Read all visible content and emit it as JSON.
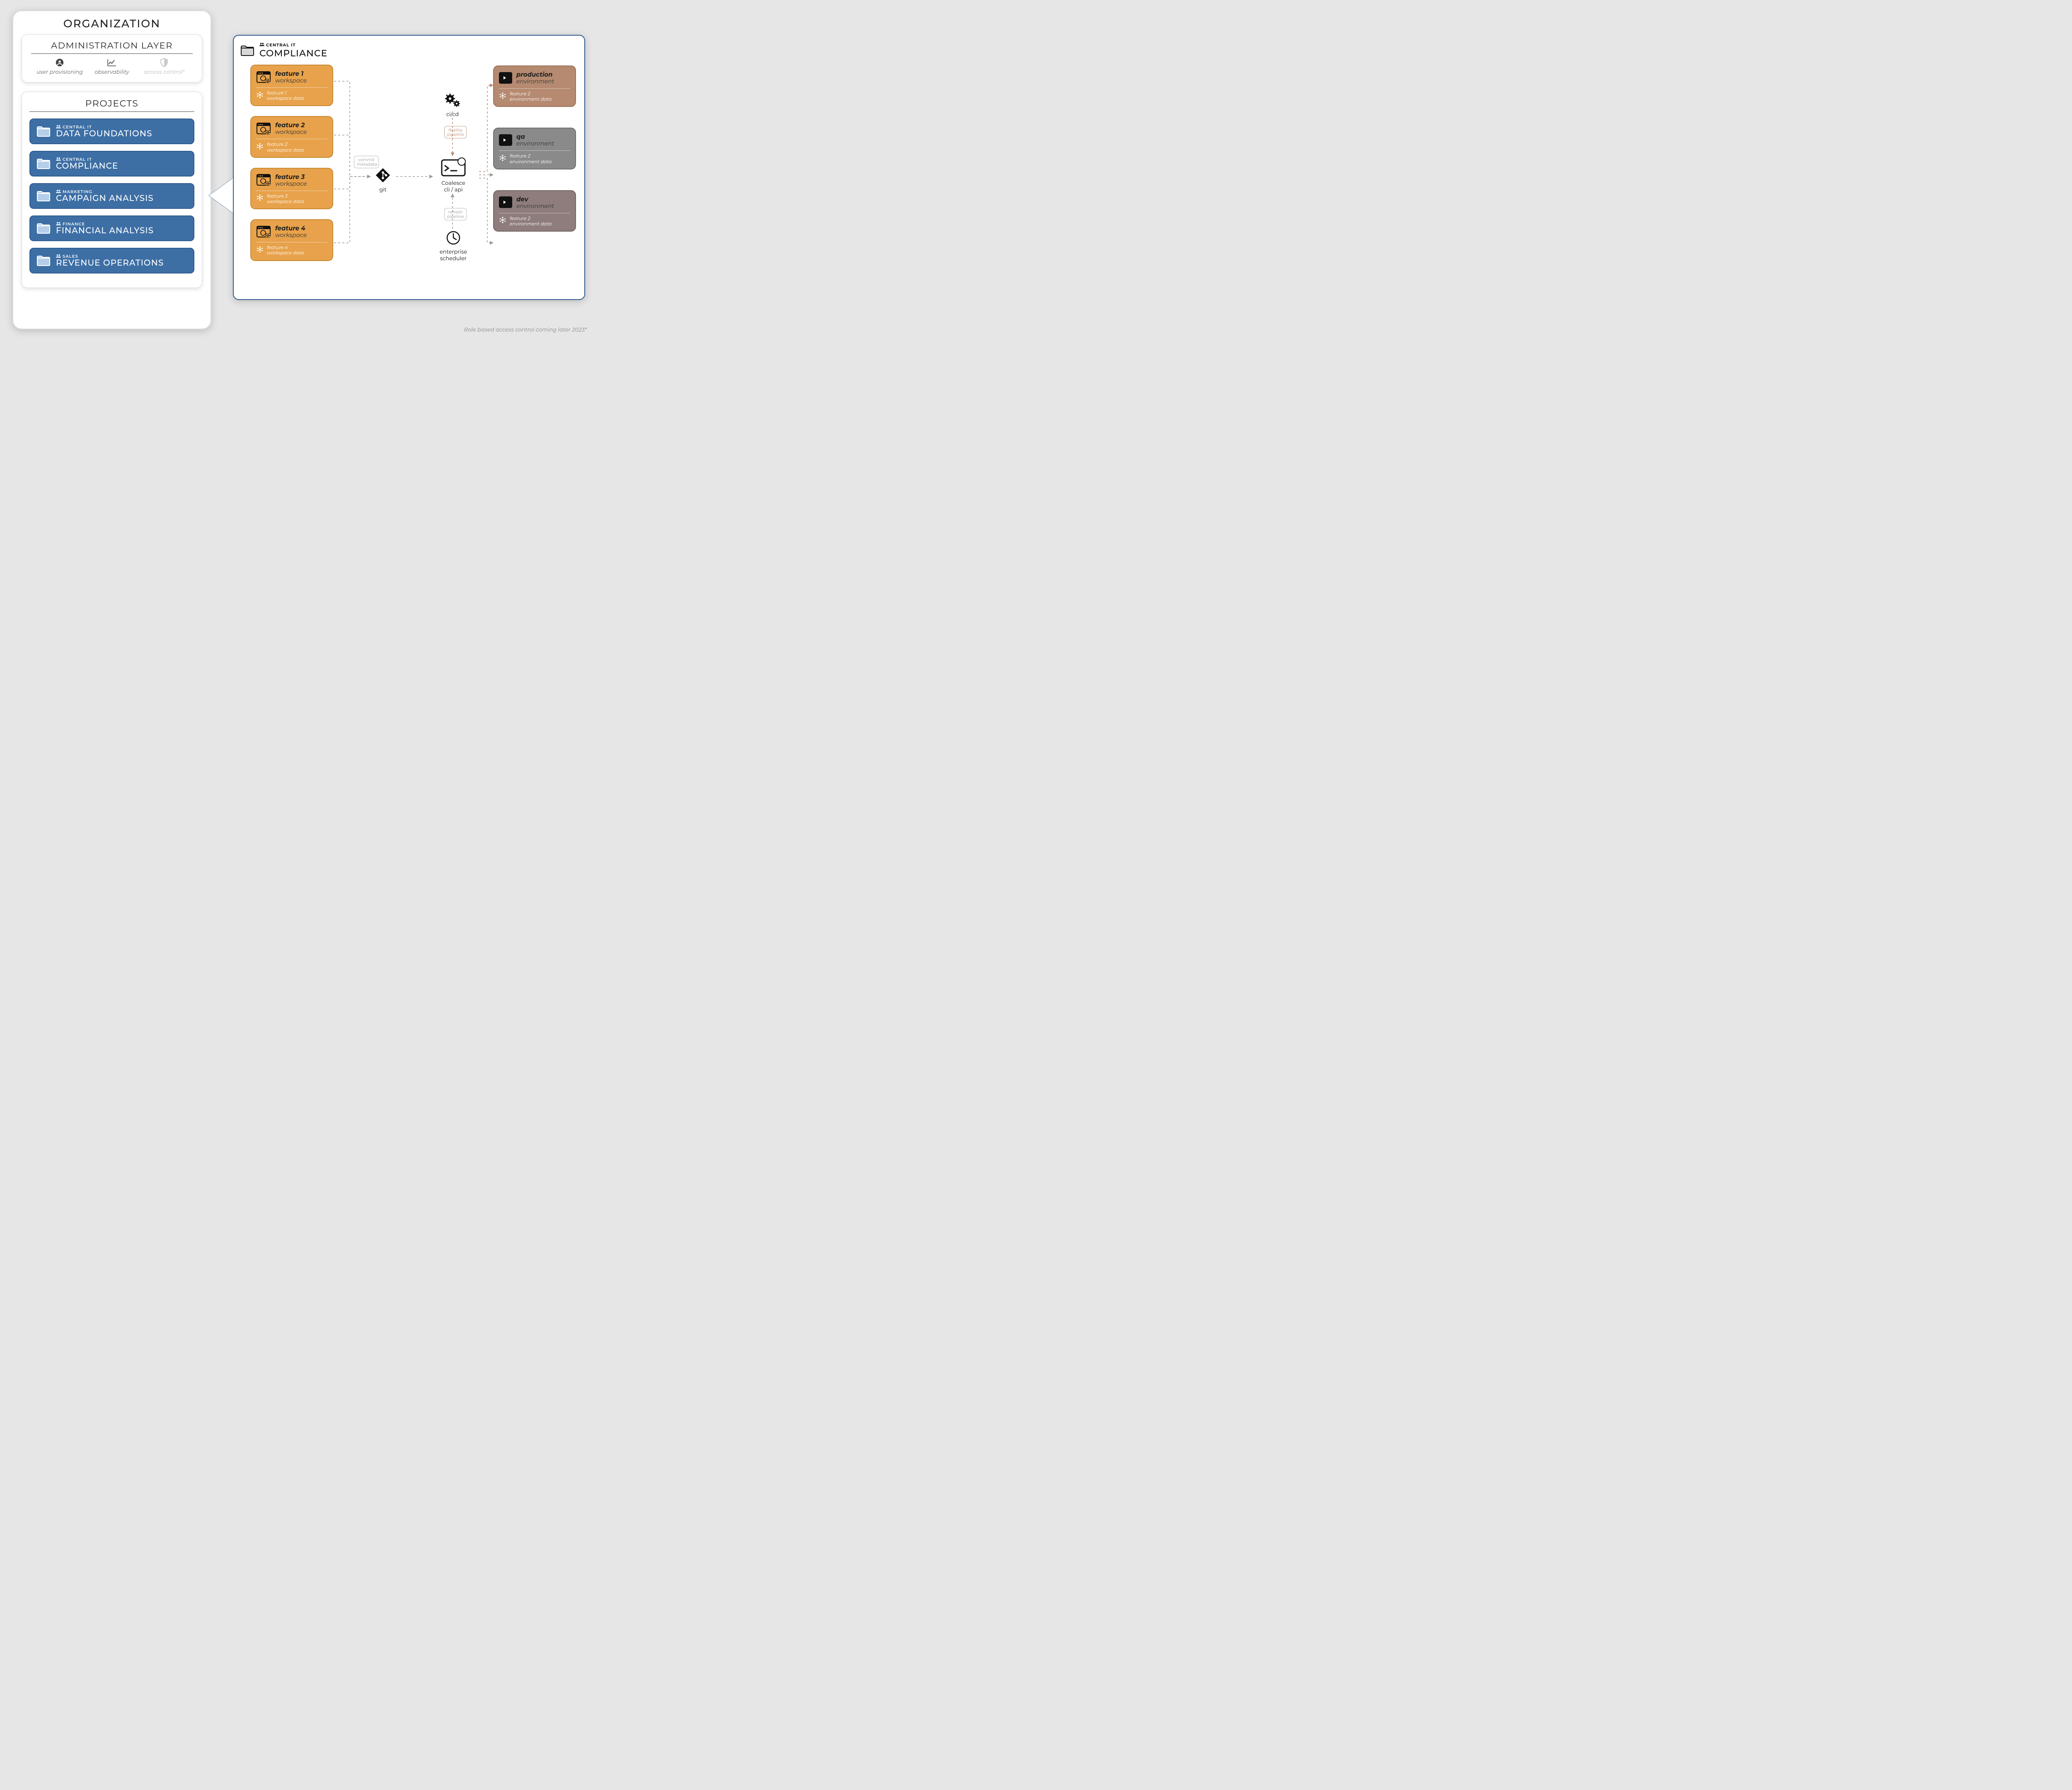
{
  "org": {
    "title": "ORGANIZATION",
    "admin": {
      "title": "ADMINISTRATION LAYER",
      "items": [
        {
          "label": "user provisioning",
          "icon": "user-circle"
        },
        {
          "label": "observability",
          "icon": "chart-line"
        },
        {
          "label": "access control*",
          "icon": "shield",
          "muted": true
        }
      ]
    },
    "projects": {
      "title": "PROJECTS",
      "items": [
        {
          "owner": "CENTRAL IT",
          "name": "DATA FOUNDATIONS"
        },
        {
          "owner": "CENTRAL IT",
          "name": "COMPLIANCE",
          "selected": true
        },
        {
          "owner": "MARKETING",
          "name": "CAMPAIGN ANALYSIS"
        },
        {
          "owner": "FINANCE",
          "name": "FINANCIAL ANALYSIS"
        },
        {
          "owner": "SALES",
          "name": "REVENUE OPERATIONS"
        }
      ]
    }
  },
  "detail": {
    "owner": "CENTRAL IT",
    "name": "COMPLIANCE",
    "workspaces": [
      {
        "title": "feature 1",
        "subtitle": "workspace",
        "data_l1": "feature 1",
        "data_l2": "workspace data"
      },
      {
        "title": "feature 2",
        "subtitle": "workspace",
        "data_l1": "feature 2",
        "data_l2": "workspace data"
      },
      {
        "title": "feature 3",
        "subtitle": "workspace",
        "data_l1": "feature 3",
        "data_l2": "workspace data"
      },
      {
        "title": "feature 4",
        "subtitle": "workspace",
        "data_l1": "feature 4",
        "data_l2": "workspace data"
      }
    ],
    "environments": [
      {
        "kind": "prod",
        "title": "production",
        "subtitle": "environment",
        "data_l1": "feature 2",
        "data_l2": "environment data"
      },
      {
        "kind": "qa",
        "title": "qa",
        "subtitle": "environment",
        "data_l1": "feature 2",
        "data_l2": "environment data"
      },
      {
        "kind": "dev",
        "title": "dev",
        "subtitle": "environment",
        "data_l1": "feature 2",
        "data_l2": "environment data"
      }
    ],
    "pipeline": {
      "git": "git",
      "cli_l1": "Coalesce",
      "cli_l2": "cli / api",
      "cicd": "ci/cd",
      "scheduler_l1": "enterprise",
      "scheduler_l2": "scheduler",
      "commit_l1": "commit",
      "commit_l2": "metadata",
      "deploy_l1": "deploy",
      "deploy_l2": "pipeline",
      "refresh_l1": "refresh",
      "refresh_l2": "pipeline"
    }
  },
  "footnote": "Role based access control coming later 2023*",
  "colors": {
    "project_bg": "#3d6fa5",
    "project_border": "#2f5a8c",
    "workspace_bg": "#e7a24b",
    "workspace_border": "#c98934",
    "env_prod": "#b58a70",
    "env_qa": "#8a8a8a",
    "env_dev": "#8e7d7c"
  }
}
